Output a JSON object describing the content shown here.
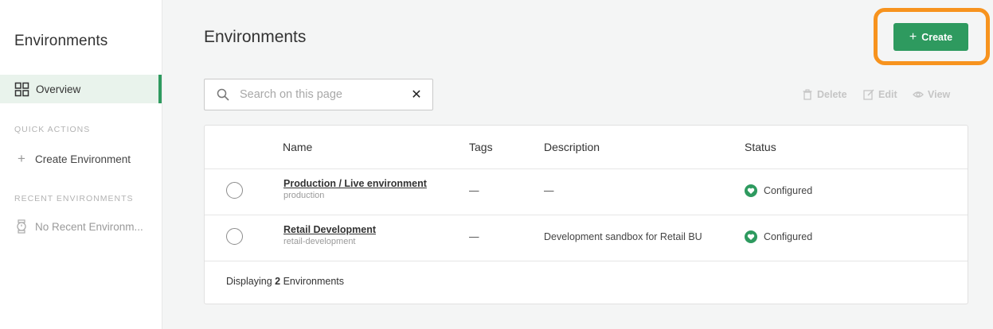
{
  "sidebar": {
    "title": "Environments",
    "nav_overview": "Overview",
    "quick_actions_label": "QUICK ACTIONS",
    "create_environment": "Create Environment",
    "recent_label": "RECENT ENVIRONMENTS",
    "no_recent": "No Recent Environm..."
  },
  "main": {
    "title": "Environments",
    "create_label": "Create",
    "search_placeholder": "Search on this page",
    "actions": {
      "delete": "Delete",
      "edit": "Edit",
      "view": "View"
    },
    "table": {
      "headers": {
        "name": "Name",
        "tags": "Tags",
        "description": "Description",
        "status": "Status"
      },
      "rows": [
        {
          "name": "Production / Live environment",
          "slug": "production",
          "tags": "—",
          "description": "—",
          "status": "Configured"
        },
        {
          "name": "Retail Development",
          "slug": "retail-development",
          "tags": "—",
          "description": "Development sandbox for Retail BU",
          "status": "Configured"
        }
      ],
      "footer_prefix": "Displaying",
      "footer_count": "2",
      "footer_suffix": "Environments"
    }
  },
  "colors": {
    "accent": "#2e9a5f",
    "highlight": "#f7931e"
  },
  "icons": [
    "grid-icon",
    "plus-icon",
    "watch-icon",
    "search-icon",
    "clear-icon",
    "trash-icon",
    "edit-icon",
    "eye-icon",
    "heart-icon"
  ]
}
